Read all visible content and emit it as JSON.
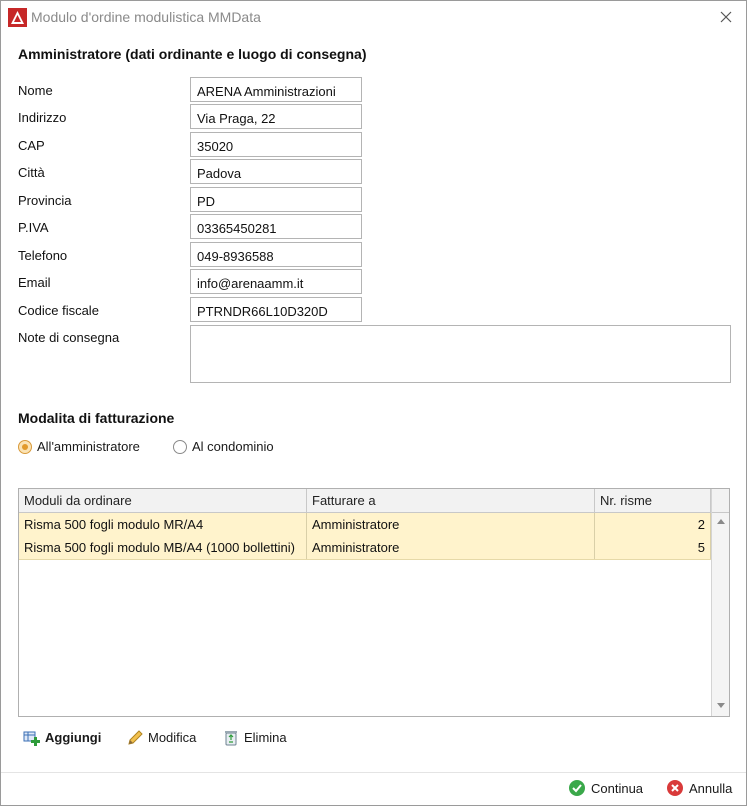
{
  "window": {
    "title": "Modulo d'ordine modulistica MMData"
  },
  "admin_section": {
    "title": "Amministratore (dati ordinante e luogo di consegna)",
    "fields": [
      {
        "label": "Nome",
        "value": "ARENA Amministrazioni"
      },
      {
        "label": "Indirizzo",
        "value": "Via Praga, 22"
      },
      {
        "label": "CAP",
        "value": "35020"
      },
      {
        "label": "Città",
        "value": "Padova"
      },
      {
        "label": "Provincia",
        "value": "PD"
      },
      {
        "label": "P.IVA",
        "value": "03365450281"
      },
      {
        "label": "Telefono",
        "value": "049-8936588"
      },
      {
        "label": "Email",
        "value": "info@arenaamm.it"
      },
      {
        "label": "Codice fiscale",
        "value": "PTRNDR66L10D320D"
      }
    ],
    "notes": {
      "label": "Note di consegna",
      "value": ""
    }
  },
  "billing": {
    "title": "Modalita di fatturazione",
    "options": [
      {
        "label": "All'amministratore",
        "selected": true
      },
      {
        "label": "Al condominio",
        "selected": false
      }
    ]
  },
  "grid": {
    "headers": [
      "Moduli da ordinare",
      "Fatturare a",
      "Nr. risme"
    ],
    "rows": [
      {
        "module": "Risma 500 fogli modulo MR/A4",
        "billing": "Amministratore",
        "qty": "2"
      },
      {
        "module": "Risma 500 fogli modulo MB/A4 (1000 bollettini)",
        "billing": "Amministratore",
        "qty": "5"
      }
    ]
  },
  "actions": {
    "add": "Aggiungi",
    "edit": "Modifica",
    "delete": "Elimina"
  },
  "footer": {
    "continue": "Continua",
    "cancel": "Annulla"
  },
  "colors": {
    "row_highlight": "#fff3cc",
    "radio_accent": "#e29a2c",
    "continue_green": "#3aa84a",
    "cancel_red": "#d93a3a",
    "app_icon_red": "#c62828"
  }
}
